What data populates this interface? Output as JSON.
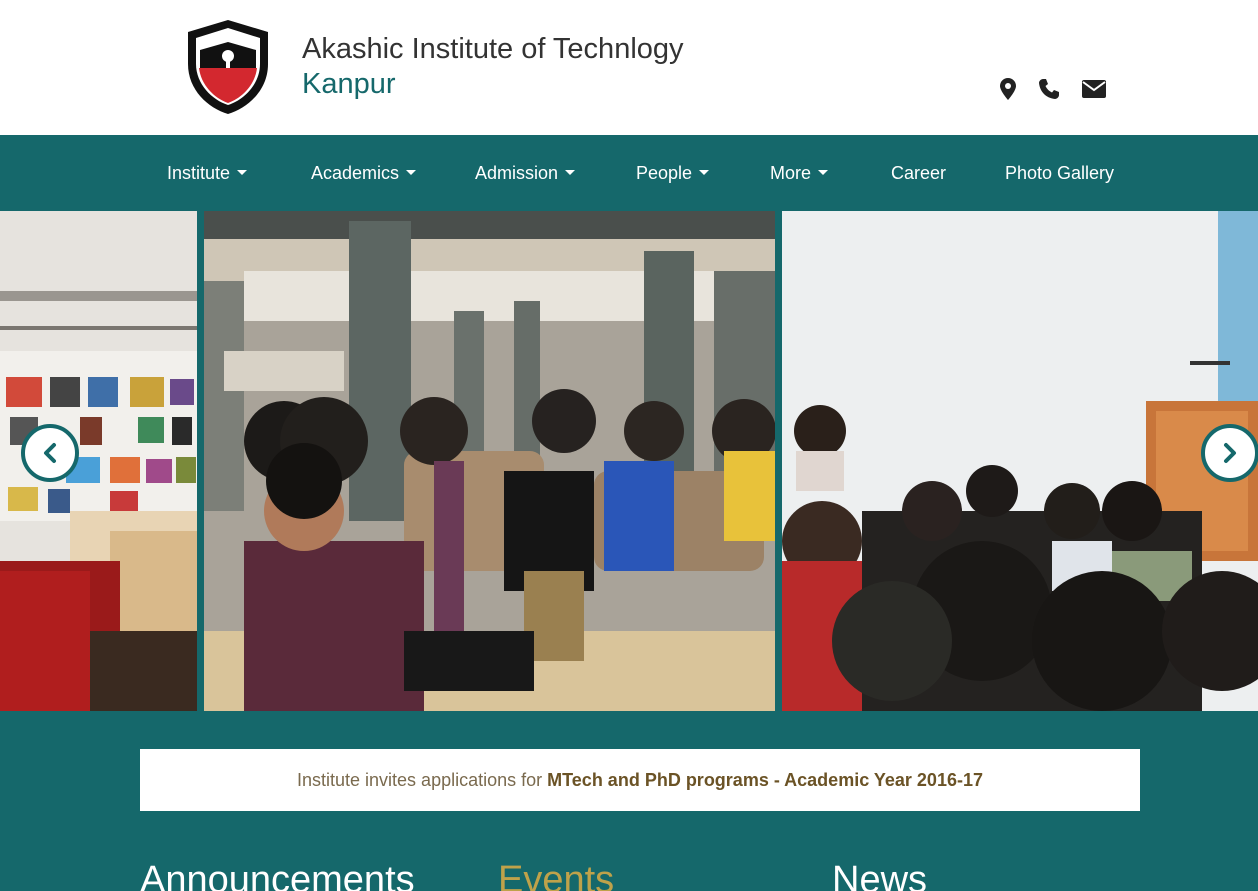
{
  "header": {
    "title": "Akashic Institute of Technlogy",
    "subtitle": "Kanpur",
    "icons": [
      "map-marker-icon",
      "phone-icon",
      "envelope-icon"
    ]
  },
  "nav": {
    "items": [
      {
        "label": "Institute",
        "dropdown": true
      },
      {
        "label": "Academics",
        "dropdown": true
      },
      {
        "label": "Admission",
        "dropdown": true
      },
      {
        "label": "People",
        "dropdown": true
      },
      {
        "label": "More",
        "dropdown": true
      },
      {
        "label": "Career",
        "dropdown": false
      },
      {
        "label": "Photo Gallery",
        "dropdown": false
      }
    ]
  },
  "carousel": {
    "prev_icon": "chevron-left-icon",
    "next_icon": "chevron-right-icon"
  },
  "notice": {
    "prefix": "Institute invites applications for",
    "highlight": "MTech and PhD programs - Academic Year 2016-17"
  },
  "sections": [
    {
      "label": "Announcements"
    },
    {
      "label": "Events"
    },
    {
      "label": "News"
    }
  ],
  "colors": {
    "primary": "#15686b",
    "accent": "#bfa24a",
    "logo_red": "#d3282f"
  }
}
